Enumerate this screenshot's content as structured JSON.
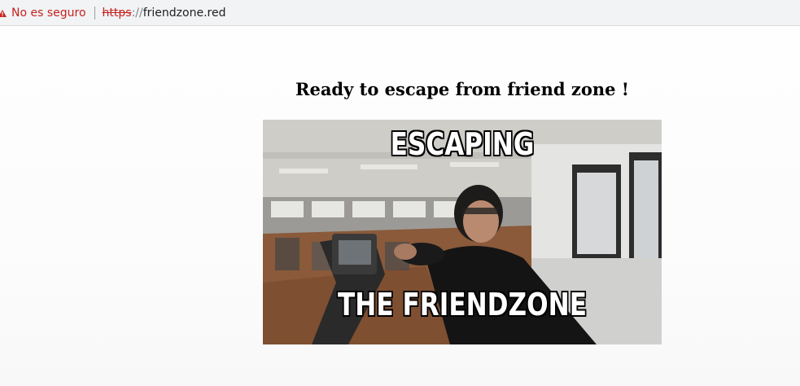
{
  "browser": {
    "security_label": "No es seguro",
    "url_scheme": "https",
    "url_separator": "://",
    "url_host": "friendzone.red",
    "warning_color": "#c5221f"
  },
  "page": {
    "headline": "Ready to escape from friend zone !",
    "meme": {
      "top_caption": "ESCAPING",
      "bottom_caption": "THE FRIENDZONE"
    }
  }
}
